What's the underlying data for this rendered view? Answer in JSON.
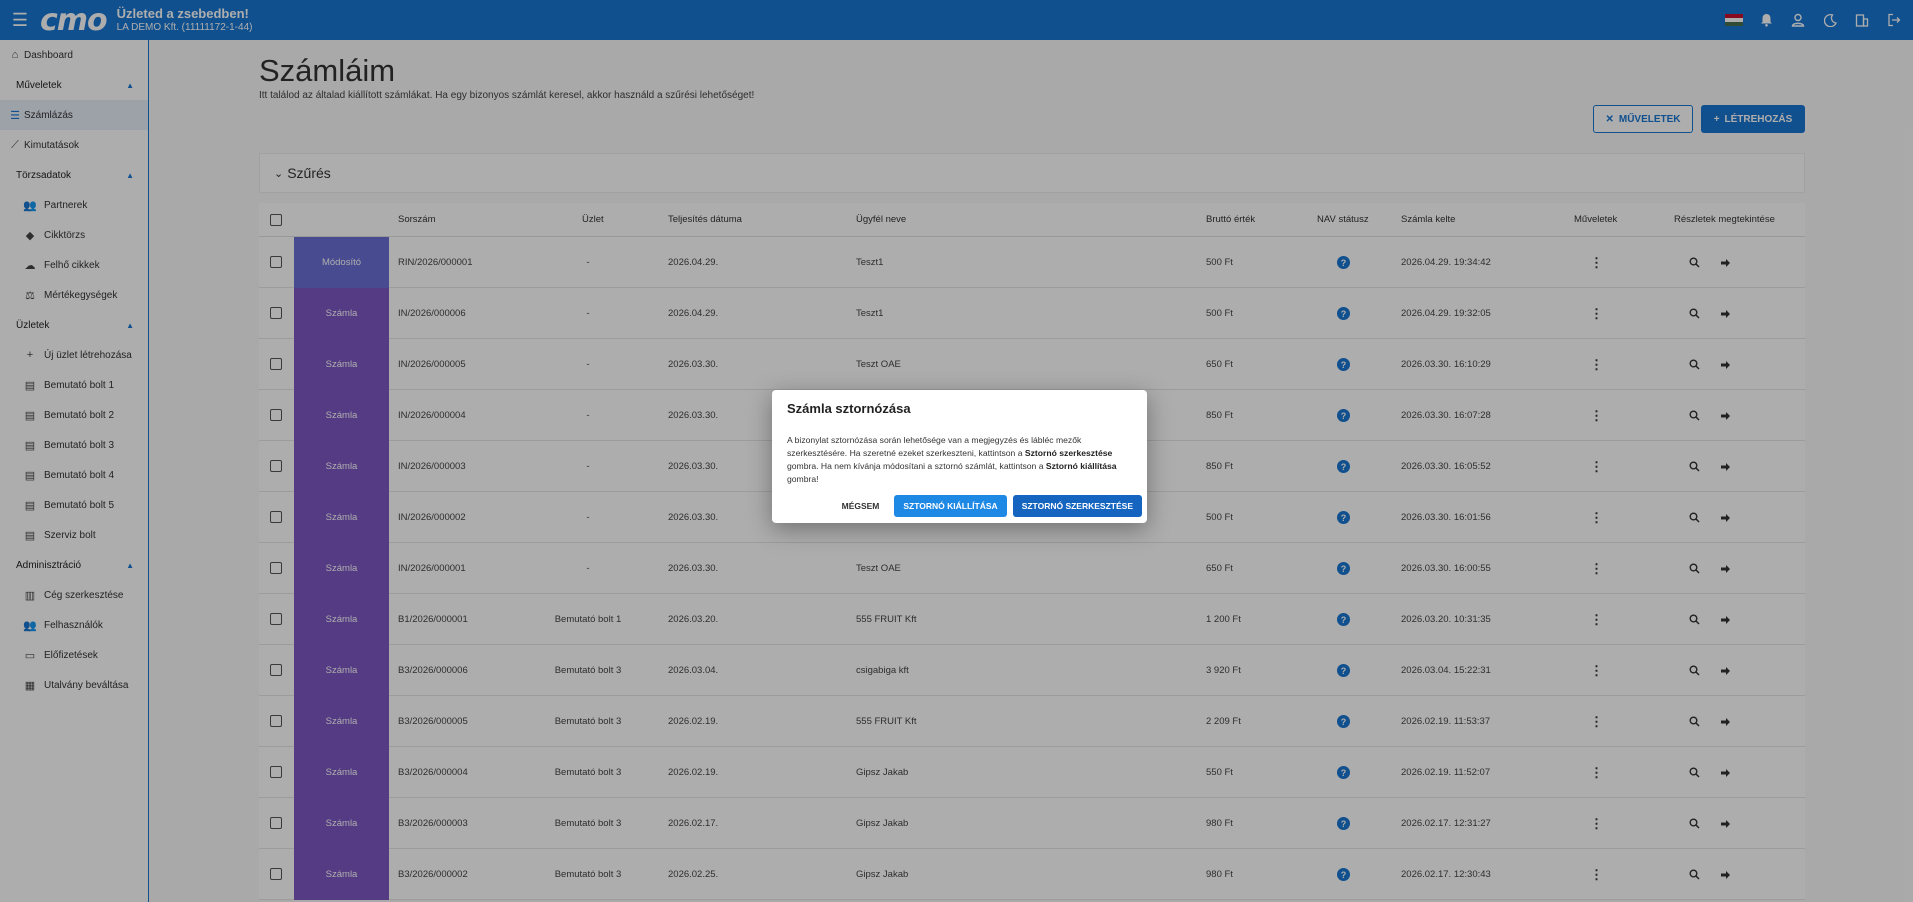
{
  "topbar": {
    "logo": "cmo",
    "shop_title": "Üzleted a zsebedben!",
    "shop_subtitle": "LA DEMO Kft. (11111172-1-44)",
    "icons": [
      "menu-icon",
      "flag-hungary-icon",
      "bell-icon",
      "user-icon",
      "moon-icon",
      "building-icon",
      "logout-icon"
    ]
  },
  "sidebar": {
    "dashboard": "Dashboard",
    "sections": [
      {
        "label": "Műveletek",
        "items": [
          "Számlázás",
          "Kimutatások"
        ]
      },
      {
        "label": "Törzsadatok",
        "items": [
          "Partnerek",
          "Cikktörzs",
          "Felhő cikkek",
          "Mértékegységek"
        ]
      },
      {
        "label": "Üzletek",
        "items": [
          "Új üzlet létrehozása",
          "Bemutató bolt 1",
          "Bemutató bolt 2",
          "Bemutató bolt 3",
          "Bemutató bolt 4",
          "Bemutató bolt 5",
          "Szerviz bolt"
        ]
      },
      {
        "label": "Adminisztráció",
        "items": [
          "Cég szerkesztése",
          "Felhasználók",
          "Előfizetések",
          "Utalvány beváltása"
        ]
      }
    ],
    "active": "Számlázás"
  },
  "page": {
    "title": "Számláim",
    "description": "Itt találod az általad kiállított számlákat. Ha egy bizonyos számlát keresel, akkor használd a szűrési lehetőséget!",
    "btn_ops": "MŰVELETEK",
    "btn_create": "LÉTREHOZÁS",
    "filter_label": "Szűrés"
  },
  "table": {
    "headers": {
      "number": "Sorszám",
      "shop": "Üzlet",
      "date": "Teljesítés dátuma",
      "client": "Ügyfél neve",
      "gross": "Bruttó érték",
      "nav": "NAV státusz",
      "issued": "Számla kelte",
      "ops": "Műveletek",
      "details": "Részletek megtekintése"
    },
    "rows": [
      {
        "type": "Módosító",
        "number": "RIN/2026/000001",
        "shop": "-",
        "date": "2026.04.29.",
        "client": "Teszt1",
        "gross": "500 Ft",
        "issued": "2026.04.29. 19:34:42"
      },
      {
        "type": "Számla",
        "number": "IN/2026/000006",
        "shop": "-",
        "date": "2026.04.29.",
        "client": "Teszt1",
        "gross": "500 Ft",
        "issued": "2026.04.29. 19:32:05"
      },
      {
        "type": "Számla",
        "number": "IN/2026/000005",
        "shop": "-",
        "date": "2026.03.30.",
        "client": "Teszt OAE",
        "gross": "650 Ft",
        "issued": "2026.03.30. 16:10:29"
      },
      {
        "type": "Számla",
        "number": "IN/2026/000004",
        "shop": "-",
        "date": "2026.03.30.",
        "client": "",
        "gross": "850 Ft",
        "issued": "2026.03.30. 16:07:28"
      },
      {
        "type": "Számla",
        "number": "IN/2026/000003",
        "shop": "-",
        "date": "2026.03.30.",
        "client": "",
        "gross": "850 Ft",
        "issued": "2026.03.30. 16:05:52"
      },
      {
        "type": "Számla",
        "number": "IN/2026/000002",
        "shop": "-",
        "date": "2026.03.30.",
        "client": "",
        "gross": "500 Ft",
        "issued": "2026.03.30. 16:01:56"
      },
      {
        "type": "Számla",
        "number": "IN/2026/000001",
        "shop": "-",
        "date": "2026.03.30.",
        "client": "Teszt OAE",
        "gross": "650 Ft",
        "issued": "2026.03.30. 16:00:55"
      },
      {
        "type": "Számla",
        "number": "B1/2026/000001",
        "shop": "Bemutató bolt 1",
        "date": "2026.03.20.",
        "client": "555 FRUIT Kft",
        "gross": "1 200 Ft",
        "issued": "2026.03.20. 10:31:35"
      },
      {
        "type": "Számla",
        "number": "B3/2026/000006",
        "shop": "Bemutató bolt 3",
        "date": "2026.03.04.",
        "client": "csigabiga kft",
        "gross": "3 920 Ft",
        "issued": "2026.03.04. 15:22:31"
      },
      {
        "type": "Számla",
        "number": "B3/2026/000005",
        "shop": "Bemutató bolt 3",
        "date": "2026.02.19.",
        "client": "555 FRUIT Kft",
        "gross": "2 209 Ft",
        "issued": "2026.02.19. 11:53:37"
      },
      {
        "type": "Számla",
        "number": "B3/2026/000004",
        "shop": "Bemutató bolt 3",
        "date": "2026.02.19.",
        "client": "Gipsz Jakab",
        "gross": "550 Ft",
        "issued": "2026.02.19. 11:52:07"
      },
      {
        "type": "Számla",
        "number": "B3/2026/000003",
        "shop": "Bemutató bolt 3",
        "date": "2026.02.17.",
        "client": "Gipsz Jakab",
        "gross": "980 Ft",
        "issued": "2026.02.17. 12:31:27"
      },
      {
        "type": "Számla",
        "number": "B3/2026/000002",
        "shop": "Bemutató bolt 3",
        "date": "2026.02.25.",
        "client": "Gipsz Jakab",
        "gross": "980 Ft",
        "issued": "2026.02.17. 12:30:43"
      }
    ]
  },
  "dialog": {
    "title": "Számla sztornózása",
    "body_part1": "A bizonylat sztornózása során lehetősége van a megjegyzés és lábléc mezők szerkesztésére. Ha szeretné ezeket szerkeszteni, kattintson a ",
    "body_bold1": "Sztornó szerkesztése",
    "body_part2": " gombra. Ha nem kívánja módosítani a sztornó számlát, kattintson a ",
    "body_bold2": "Sztornó kiállítása",
    "body_part3": " gombra!",
    "btn_cancel": "MÉGSEM",
    "btn_issue": "SZTORNÓ KIÁLLÍTÁSA",
    "btn_edit": "SZTORNÓ SZERKESZTÉSE"
  },
  "colors": {
    "primary": "#1976d2",
    "invoice_type": "#7e57c2",
    "modifier_type": "#6a6fd4"
  }
}
